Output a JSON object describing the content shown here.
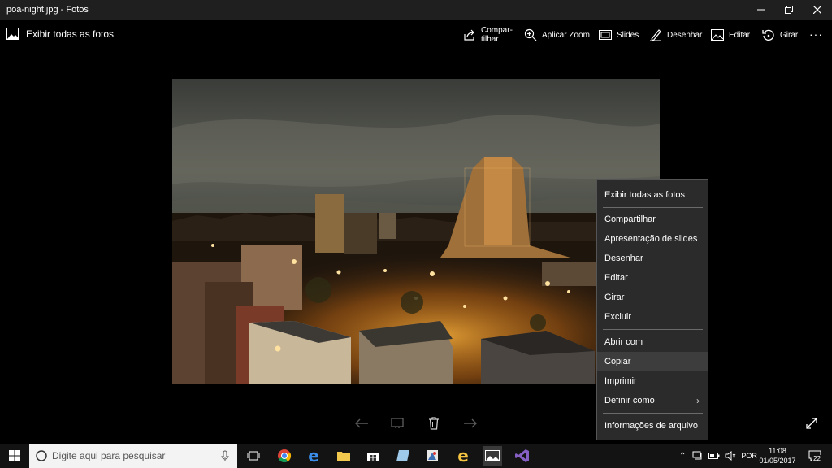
{
  "window": {
    "title": "poa-night.jpg - Fotos",
    "minimize_icon": "minimize-icon",
    "restore_icon": "restore-icon",
    "close_icon": "close-icon"
  },
  "toolbar": {
    "show_all": "Exibir todas as fotos",
    "share_line1": "Compar-",
    "share_line2": "tilhar",
    "zoom": "Aplicar Zoom",
    "slides": "Slides",
    "draw": "Desenhar",
    "edit": "Editar",
    "rotate": "Girar",
    "more": "···"
  },
  "context_menu": {
    "items": [
      "Exibir todas as fotos",
      "Compartilhar",
      "Apresentação de slides",
      "Desenhar",
      "Editar",
      "Girar",
      "Excluir",
      "Abrir com",
      "Copiar",
      "Imprimir",
      "Definir como",
      "Informações de arquivo"
    ],
    "highlighted": "Copiar"
  },
  "taskbar": {
    "search_placeholder": "Digite aqui para pesquisar",
    "language": "POR",
    "time": "11:08",
    "date": "01/05/2017",
    "notifications": "22"
  },
  "colors": {
    "menu_bg": "#2b2b2b",
    "menu_highlight": "#3d3d3d",
    "titlebar_bg": "#1f1f1f",
    "taskbar_bg": "#131313"
  }
}
